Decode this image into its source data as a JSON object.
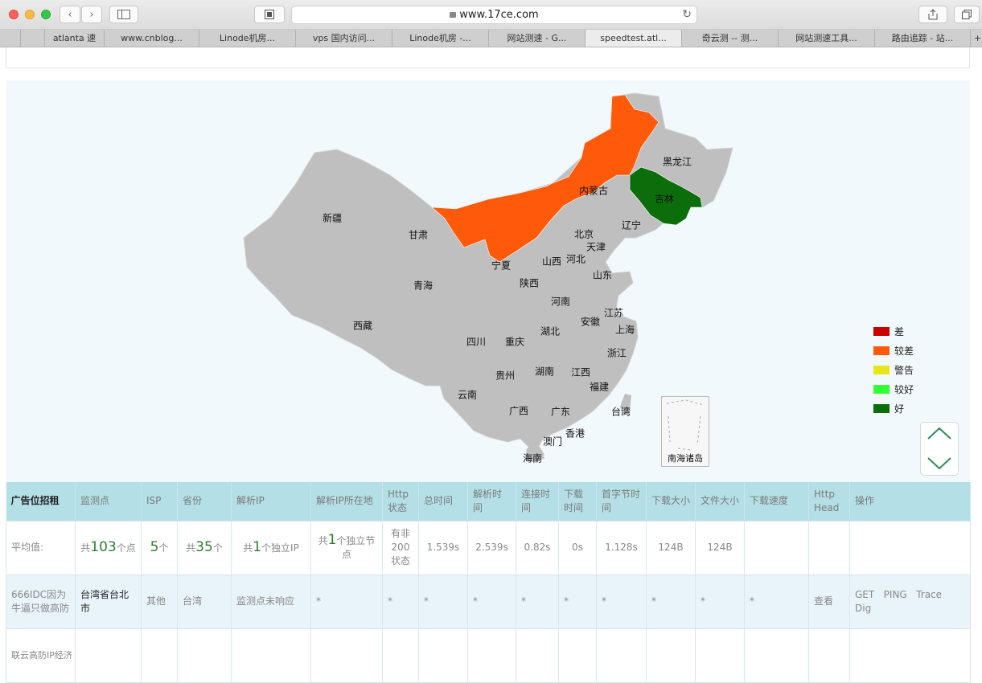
{
  "browser": {
    "url": "www.17ce.com",
    "tabs": [
      "",
      "atlanta 速",
      "www.cnblog...",
      "Linode机房...",
      "vps 国内访问...",
      "Linode机房 -...",
      "网站测速 - G...",
      "speedtest.atl...",
      "奇云测 -- 测...",
      "网站测速工具...",
      "路由追踪 - 站..."
    ],
    "active_tab": 7
  },
  "map": {
    "provinces": [
      {
        "name": "黑龙江"
      },
      {
        "name": "内蒙古"
      },
      {
        "name": "吉林"
      },
      {
        "name": "新疆"
      },
      {
        "name": "辽宁"
      },
      {
        "name": "甘肃"
      },
      {
        "name": "北京"
      },
      {
        "name": "天津"
      },
      {
        "name": "宁夏"
      },
      {
        "name": "山西"
      },
      {
        "name": "河北"
      },
      {
        "name": "青海"
      },
      {
        "name": "陕西"
      },
      {
        "name": "山东"
      },
      {
        "name": "河南"
      },
      {
        "name": "江苏"
      },
      {
        "name": "西藏"
      },
      {
        "name": "安徽"
      },
      {
        "name": "上海"
      },
      {
        "name": "湖北"
      },
      {
        "name": "四川"
      },
      {
        "name": "重庆"
      },
      {
        "name": "浙江"
      },
      {
        "name": "贵州"
      },
      {
        "name": "湖南"
      },
      {
        "name": "江西"
      },
      {
        "name": "福建"
      },
      {
        "name": "云南"
      },
      {
        "name": "广西"
      },
      {
        "name": "广东"
      },
      {
        "name": "台湾"
      },
      {
        "name": "香港"
      },
      {
        "name": "澳门"
      },
      {
        "name": "海南"
      }
    ],
    "inset_label": "南海诸岛",
    "colors": {
      "base": "#bfbfbf",
      "orange": "#ff5a0a",
      "green": "#0b6e0b"
    }
  },
  "legend": [
    {
      "label": "差",
      "color": "#cc0000"
    },
    {
      "label": "较差",
      "color": "#ff5a0a"
    },
    {
      "label": "警告",
      "color": "#e6e61a"
    },
    {
      "label": "较好",
      "color": "#33ff33"
    },
    {
      "label": "好",
      "color": "#0b6e0b"
    }
  ],
  "table": {
    "headers": [
      "广告位招租",
      "监测点",
      "ISP",
      "省份",
      "解析IP",
      "解析IP所在地",
      "Http状态",
      "总时间",
      "解析时间",
      "连接时间",
      "下载时间",
      "首字节时间",
      "下载大小",
      "文件大小",
      "下载速度",
      "Http Head",
      "操作"
    ],
    "avg": {
      "label": "平均值:",
      "monitor_pre": "共",
      "monitor_num": "103",
      "monitor_post": "个点",
      "isp_num": "5",
      "isp_post": "个",
      "prov_pre": "共",
      "prov_num": "35",
      "prov_post": "个",
      "ip_pre": "共",
      "ip_num": "1",
      "ip_post": "个独立IP",
      "loc_pre": "共",
      "loc_num": "1",
      "loc_post": "个独立节点",
      "http": "有非200状态",
      "total": "1.539s",
      "dns": "2.539s",
      "connect": "0.82s",
      "download": "0s",
      "ttfb": "1.128s",
      "dl_size": "124B",
      "file_size": "124B"
    },
    "row1": {
      "ad": "666IDC因为牛逼只做高防",
      "monitor": "台湾省台北市",
      "isp": "其他",
      "province": "台湾",
      "ip": "监测点未响应",
      "star": "*",
      "head": "查看",
      "ops": [
        "GET",
        "PING",
        "Trace",
        "Dig"
      ]
    },
    "row2_ad": "联云高防IP经济"
  }
}
